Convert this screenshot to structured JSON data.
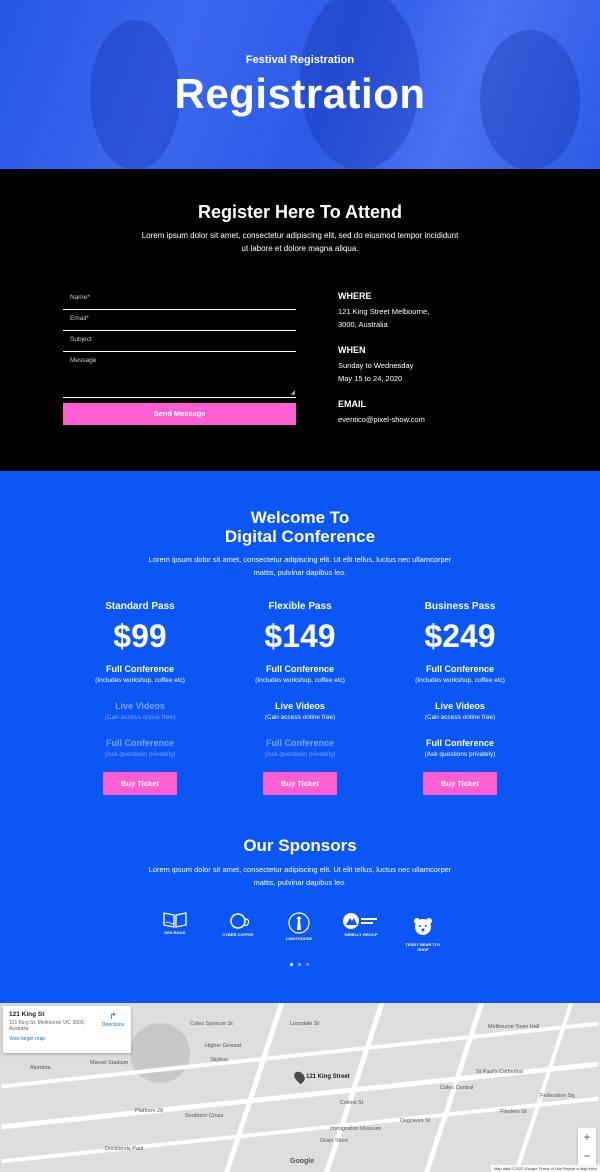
{
  "hero": {
    "subtitle": "Festival Registration",
    "title": "Registration"
  },
  "register": {
    "title": "Register Here To Attend",
    "text": "Lorem ipsum dolor sit amet, consectetur adipiscing elit, sed do eiusmod tempor incididunt ut labore et dolore magna aliqua.",
    "form": {
      "name_placeholder": "Name*",
      "email_placeholder": "Email*",
      "subject_placeholder": "Subject",
      "message_placeholder": "Message",
      "send_label": "Send Message"
    },
    "info": {
      "where_title": "WHERE",
      "where_line1": "121 King Street Melbourne,",
      "where_line2": "3000, Australia",
      "when_title": "WHEN",
      "when_line1": "Sunday to Wednesday",
      "when_line2": "May 15 to 24, 2020",
      "email_title": "EMAIL",
      "email_value": "eventico@pixel-show.com"
    }
  },
  "conference": {
    "title_line1": "Welcome To",
    "title_line2": "Digital Conference",
    "text": "Lorem ipsum dolor sit amet, consectetur adipiscing elit. Ut elit tellus, luctus nec ullamcorper mattis, pulvinar dapibus leo.",
    "passes": [
      {
        "name": "Standard Pass",
        "price": "$99",
        "f1": "Full Conference",
        "d1": "(Includes workshop, coffee etc)",
        "f2": "Live Videos",
        "d2": "(Can access online free)",
        "f3": "Full Conference",
        "d3": "(Ask questions privately)",
        "button": "Buy Ticket"
      },
      {
        "name": "Flexible Pass",
        "price": "$149",
        "f1": "Full Conference",
        "d1": "(Includes workshop, coffee etc)",
        "f2": "Live Videos",
        "d2": "(Can access online free)",
        "f3": "Full Conference",
        "d3": "(Ask questions privately)",
        "button": "Buy Ticket"
      },
      {
        "name": "Business Pass",
        "price": "$249",
        "f1": "Full Conference",
        "d1": "(Includes workshop, coffee etc)",
        "f2": "Live Videos",
        "d2": "(Can access online free)",
        "f3": "Full Conference",
        "d3": "(Ask questions privately)",
        "button": "Buy Ticket"
      }
    ]
  },
  "sponsors": {
    "title": "Our Sponsors",
    "text": "Lorem ipsum dolor sit amet, consectetur adipiscing elit. Ut elit tellus, luctus nec ullamcorper mattis, pulvinar dapibus leo.",
    "logos": [
      "SEA BOOK",
      "CYBER COFFEE",
      "LIGHTHOUSE",
      "MIRELLY GROUP",
      "TEDDY BEAR TOY SHOP"
    ]
  },
  "map": {
    "card_title": "121 King St",
    "card_address": "121 King St, Melbourne VIC 3000, Australia",
    "directions": "Directions",
    "larger_map": "View larger map",
    "pin_label": "121 King Street",
    "labels": [
      "Coles Spencer St",
      "Higher Ground",
      "Skybus",
      "Marvel Stadium",
      "Alumbra",
      "Platform 28",
      "Southern Cross",
      "Docklands Park",
      "Lonsdale St",
      "Flinders St",
      "Collins St",
      "Melbourne Town Hall",
      "St Paul's Cathedral",
      "Immigration Museum",
      "Grain Store",
      "Degraves St",
      "Coles Central",
      "Federation Sq"
    ],
    "attribution": "Map data ©2022 Google   Terms of Use   Report a map error",
    "zoom_in": "+",
    "zoom_out": "−",
    "google": "Google"
  },
  "colors": {
    "accent": "#ff5fd0",
    "blue": "#0c56f5",
    "black": "#000000"
  }
}
